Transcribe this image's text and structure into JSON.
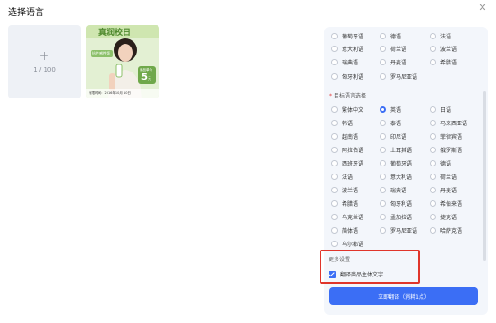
{
  "dialog": {
    "title": "选择语言"
  },
  "upload": {
    "plus": "+",
    "count": "1 / 100"
  },
  "thumbnail": {
    "logo_text": "真润校日",
    "tag": "抗性感性版",
    "badge_top": "商品单价",
    "badge_price": "5",
    "badge_unit": "元",
    "date_text": "有限时间：2016年10月 10日"
  },
  "source_languages": [
    {
      "label": "葡萄牙语",
      "checked": false
    },
    {
      "label": "德语",
      "checked": false
    },
    {
      "label": "法语",
      "checked": false
    },
    {
      "label": "意大利语",
      "checked": false
    },
    {
      "label": "荷兰语",
      "checked": false
    },
    {
      "label": "波兰语",
      "checked": false
    },
    {
      "label": "瑞典语",
      "checked": false
    },
    {
      "label": "丹麦语",
      "checked": false
    },
    {
      "label": "希腊语",
      "checked": false
    },
    {
      "label": "匈牙利语",
      "checked": false
    },
    {
      "label": "罗马尼亚语",
      "checked": false
    }
  ],
  "target_label": "目标语言选择",
  "target_required_mark": "*",
  "target_languages": [
    {
      "label": "繁体中文",
      "checked": false
    },
    {
      "label": "英语",
      "checked": true
    },
    {
      "label": "日语",
      "checked": false
    },
    {
      "label": "韩语",
      "checked": false
    },
    {
      "label": "泰语",
      "checked": false
    },
    {
      "label": "马来西亚语",
      "checked": false
    },
    {
      "label": "越南语",
      "checked": false
    },
    {
      "label": "印尼语",
      "checked": false
    },
    {
      "label": "菲律宾语",
      "checked": false
    },
    {
      "label": "阿拉伯语",
      "checked": false
    },
    {
      "label": "土耳其语",
      "checked": false
    },
    {
      "label": "俄罗斯语",
      "checked": false
    },
    {
      "label": "西班牙语",
      "checked": false
    },
    {
      "label": "葡萄牙语",
      "checked": false
    },
    {
      "label": "德语",
      "checked": false
    },
    {
      "label": "法语",
      "checked": false
    },
    {
      "label": "意大利语",
      "checked": false
    },
    {
      "label": "荷兰语",
      "checked": false
    },
    {
      "label": "波兰语",
      "checked": false
    },
    {
      "label": "瑞典语",
      "checked": false
    },
    {
      "label": "丹麦语",
      "checked": false
    },
    {
      "label": "希腊语",
      "checked": false
    },
    {
      "label": "匈牙利语",
      "checked": false
    },
    {
      "label": "希伯来语",
      "checked": false
    },
    {
      "label": "乌克兰语",
      "checked": false
    },
    {
      "label": "孟加拉语",
      "checked": false
    },
    {
      "label": "捷克语",
      "checked": false
    },
    {
      "label": "简体语",
      "checked": false
    },
    {
      "label": "罗马尼亚语",
      "checked": false
    },
    {
      "label": "哈萨克语",
      "checked": false
    },
    {
      "label": "乌尔都语",
      "checked": false
    }
  ],
  "more_settings": {
    "title": "更多设置",
    "checkbox_label": "翻译商品主体文字",
    "checked": true
  },
  "action": {
    "translate_label": "立即翻译（消耗1点）"
  },
  "colors": {
    "accent": "#3b6ef5",
    "highlight_border": "#e0352b",
    "panel_bg": "#f3f6fb"
  }
}
